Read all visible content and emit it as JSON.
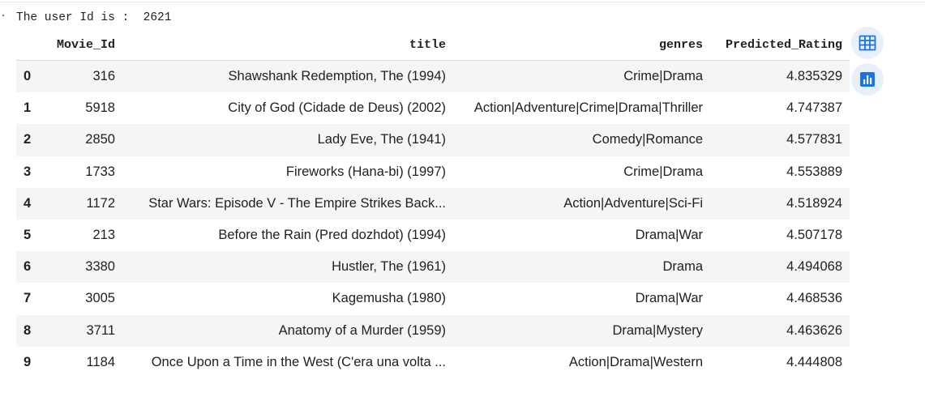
{
  "output": {
    "text": "The user Id is :  2621"
  },
  "table": {
    "columns": [
      "",
      "Movie_Id",
      "title",
      "genres",
      "Predicted_Rating"
    ],
    "rows": [
      {
        "index": "0",
        "movie_id": "316",
        "title": "Shawshank Redemption, The (1994)",
        "genres": "Crime|Drama",
        "rating": "4.835329"
      },
      {
        "index": "1",
        "movie_id": "5918",
        "title": "City of God (Cidade de Deus) (2002)",
        "genres": "Action|Adventure|Crime|Drama|Thriller",
        "rating": "4.747387"
      },
      {
        "index": "2",
        "movie_id": "2850",
        "title": "Lady Eve, The (1941)",
        "genres": "Comedy|Romance",
        "rating": "4.577831"
      },
      {
        "index": "3",
        "movie_id": "1733",
        "title": "Fireworks (Hana-bi) (1997)",
        "genres": "Crime|Drama",
        "rating": "4.553889"
      },
      {
        "index": "4",
        "movie_id": "1172",
        "title": "Star Wars: Episode V - The Empire Strikes Back...",
        "genres": "Action|Adventure|Sci-Fi",
        "rating": "4.518924"
      },
      {
        "index": "5",
        "movie_id": "213",
        "title": "Before the Rain (Pred dozhdot) (1994)",
        "genres": "Drama|War",
        "rating": "4.507178"
      },
      {
        "index": "6",
        "movie_id": "3380",
        "title": "Hustler, The (1961)",
        "genres": "Drama",
        "rating": "4.494068"
      },
      {
        "index": "7",
        "movie_id": "3005",
        "title": "Kagemusha (1980)",
        "genres": "Drama|War",
        "rating": "4.468536"
      },
      {
        "index": "8",
        "movie_id": "3711",
        "title": "Anatomy of a Murder (1959)",
        "genres": "Drama|Mystery",
        "rating": "4.463626"
      },
      {
        "index": "9",
        "movie_id": "1184",
        "title": "Once Upon a Time in the West (C'era una volta ...",
        "genres": "Action|Drama|Western",
        "rating": "4.444808"
      }
    ]
  },
  "actions": {
    "table_icon": "table-icon",
    "chart_icon": "bar-chart-icon",
    "accent_color": "#1a73e8"
  }
}
